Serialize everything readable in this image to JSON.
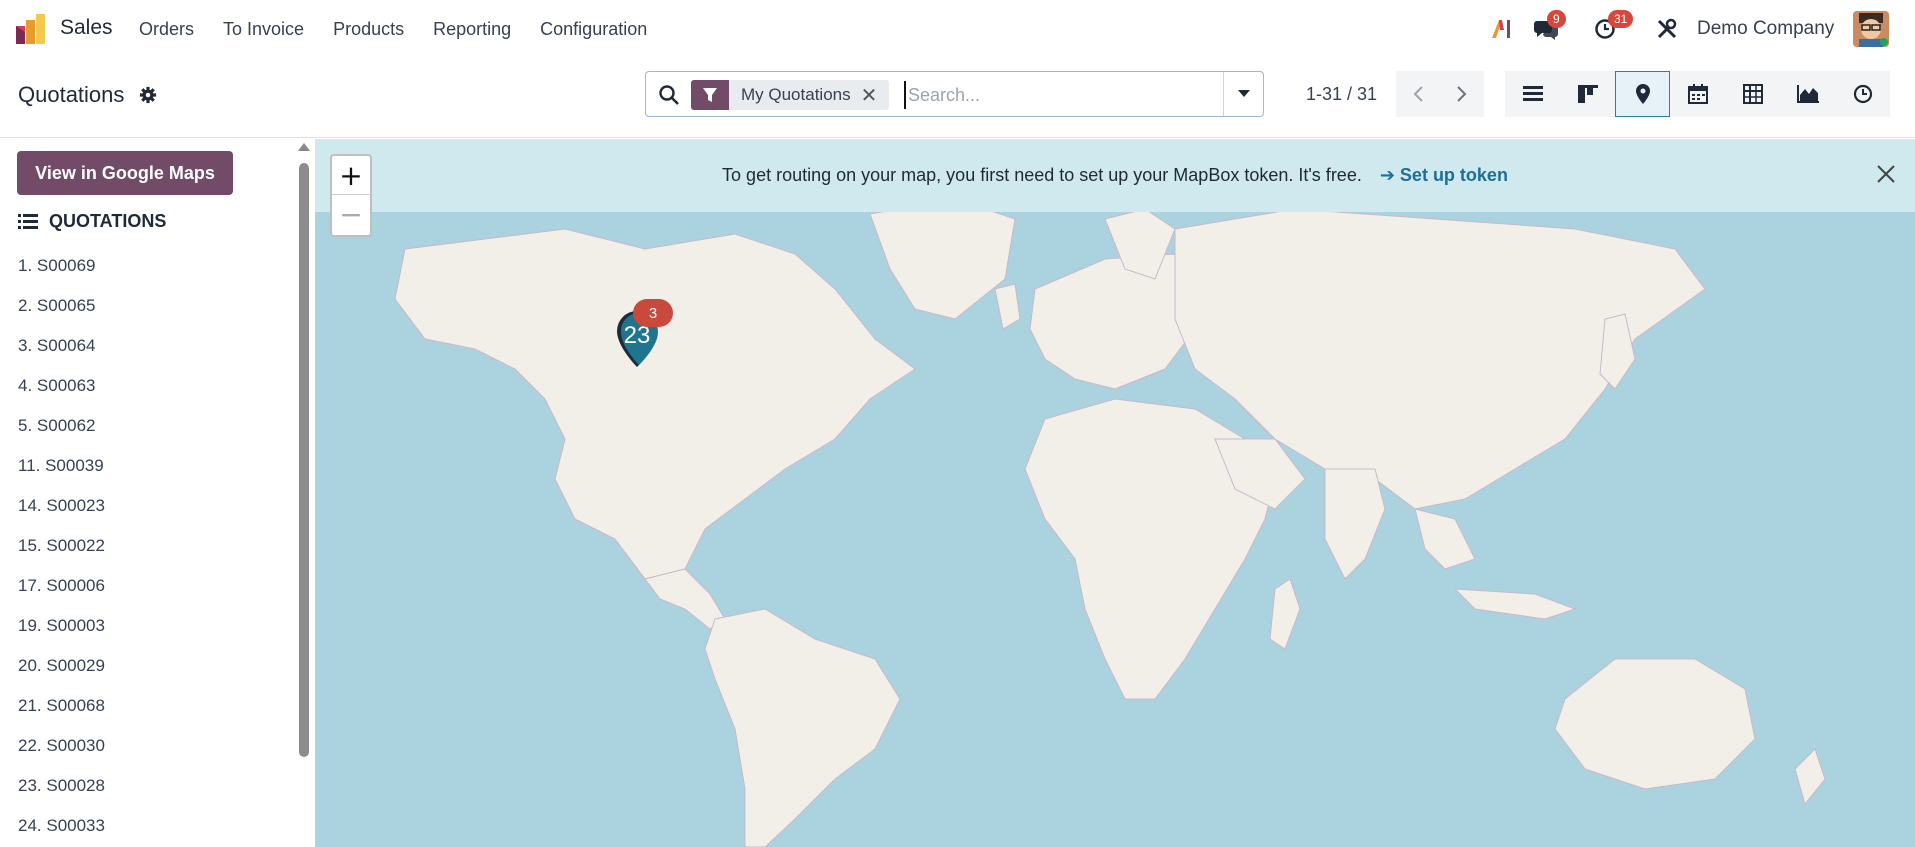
{
  "app": {
    "name": "Sales",
    "menu": [
      "Orders",
      "To Invoice",
      "Products",
      "Reporting",
      "Configuration"
    ],
    "company": "Demo Company",
    "messages_badge": "9",
    "activities_badge": "31"
  },
  "control_panel": {
    "title": "Quotations",
    "facet_label": "My Quotations",
    "search_placeholder": "Search...",
    "pager": "1-31 / 31",
    "views": [
      "list-icon",
      "kanban-icon",
      "map-icon",
      "calendar-icon",
      "pivot-icon",
      "graph-icon",
      "activity-icon"
    ],
    "active_view": "map-icon"
  },
  "sidebar": {
    "google_maps_button": "View in Google Maps",
    "list_header": "QUOTATIONS",
    "records": [
      "1. S00069",
      "2. S00065",
      "3. S00064",
      "4. S00063",
      "5. S00062",
      "11. S00039",
      "14. S00023",
      "15. S00022",
      "17. S00006",
      "19. S00003",
      "20. S00029",
      "21. S00068",
      "22. S00030",
      "23. S00028",
      "24. S00033"
    ]
  },
  "map": {
    "notice_text": "To get routing on your map, you first need to set up your MapBox token. It's free.",
    "notice_link": "➔ Set up token",
    "zoom_in": "+",
    "zoom_out": "−",
    "marker_count": "23",
    "marker_badge": "3"
  },
  "colors": {
    "brand": "#714b67",
    "badge": "#d9463b",
    "water": "#aad3df",
    "land": "#f2efe9",
    "link": "#1d6f9a"
  }
}
